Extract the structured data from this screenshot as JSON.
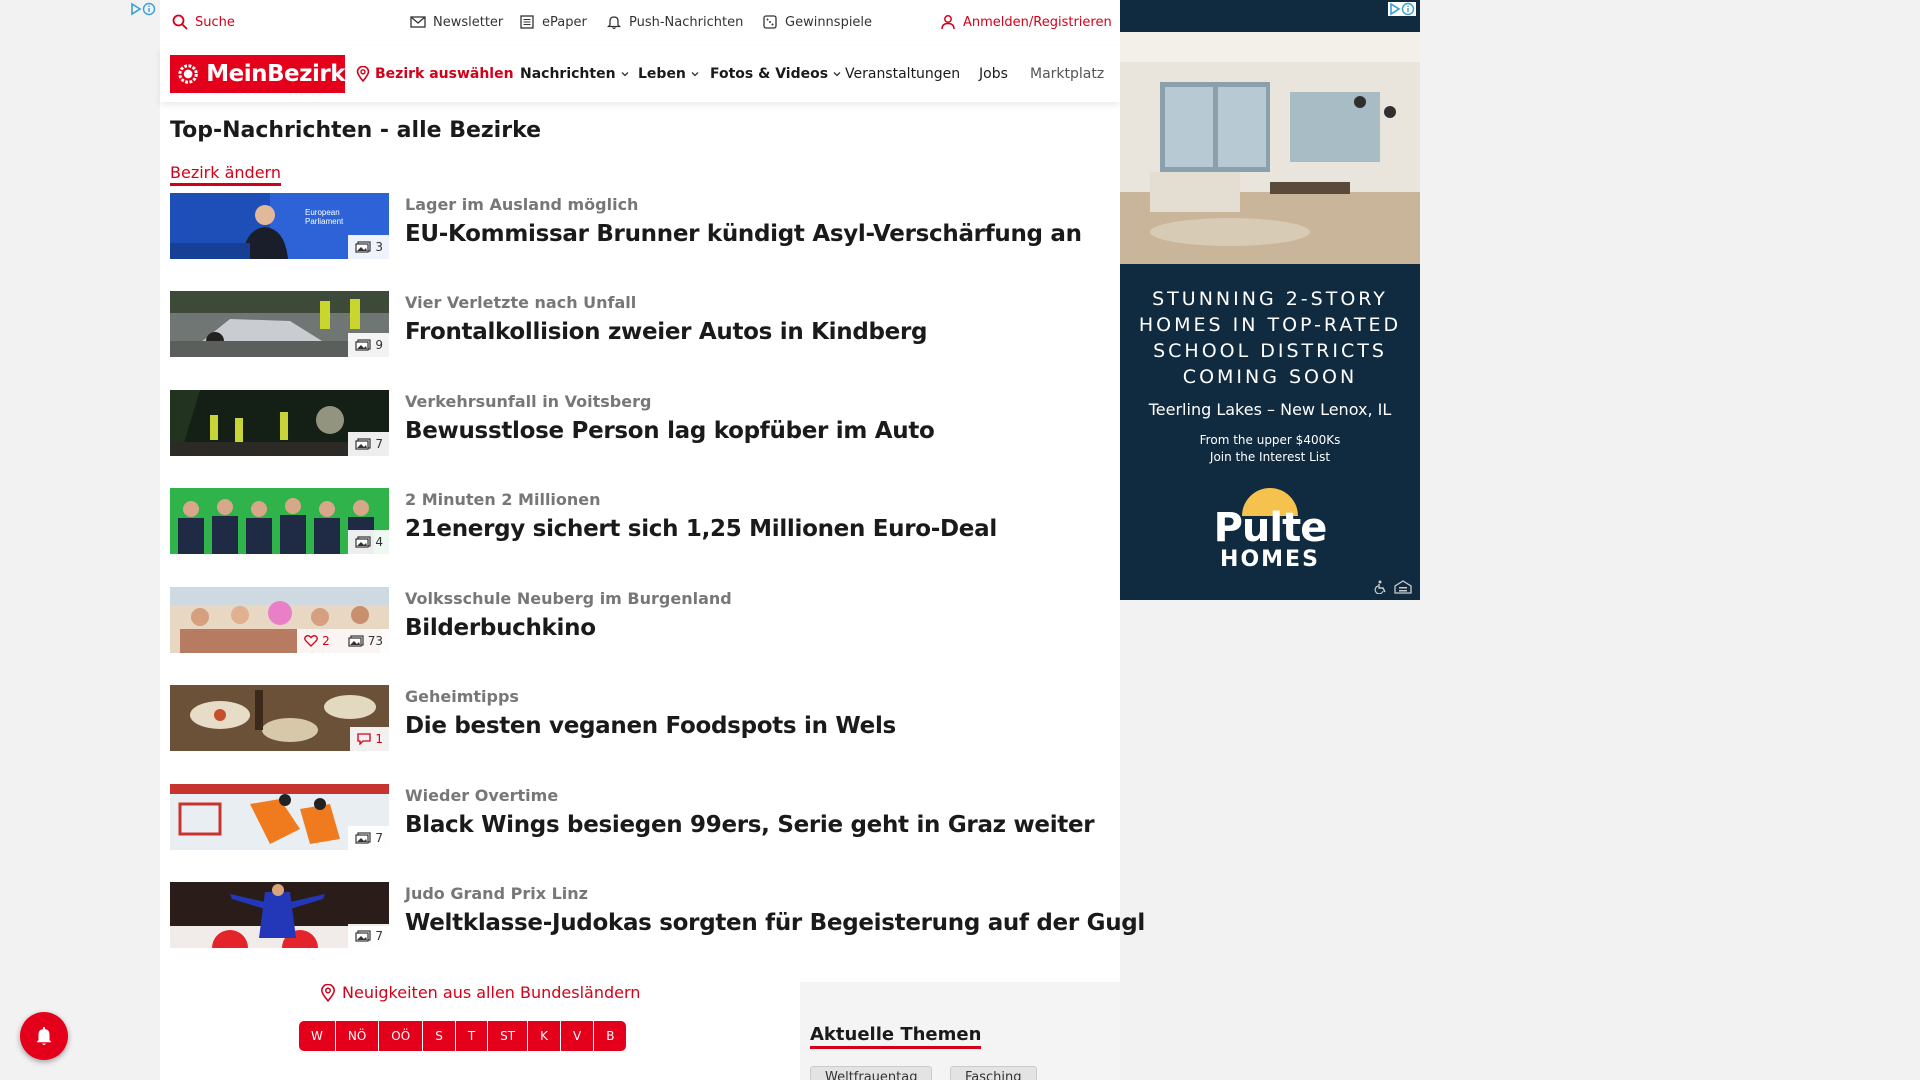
{
  "utility_bar": {
    "search": "Suche",
    "newsletter": "Newsletter",
    "epaper": "ePaper",
    "push": "Push-Nachrichten",
    "gewinnspiele": "Gewinnspiele",
    "login": "Anmelden/Registrieren"
  },
  "nav": {
    "logo": "MeinBezirk",
    "bezirk": "Bezirk auswählen",
    "items": [
      "Nachrichten",
      "Leben",
      "Fotos & Videos",
      "Veranstaltungen",
      "Jobs",
      "Marktplatz"
    ]
  },
  "section": {
    "title": "Top-Nachrichten - alle Bezirke",
    "change_link": "Bezirk ändern"
  },
  "articles": [
    {
      "kicker": "Lager im Ausland möglich",
      "headline": "EU-Kommissar Brunner kündigt Asyl-Verschärfung an",
      "photos": "3",
      "likes": "",
      "comments": ""
    },
    {
      "kicker": "Vier Verletzte nach Unfall",
      "headline": "Frontalkollision zweier Autos in Kindberg",
      "photos": "9",
      "likes": "",
      "comments": ""
    },
    {
      "kicker": "Verkehrsunfall in Voitsberg",
      "headline": "Bewusstlose Person lag kopfüber im Auto",
      "photos": "7",
      "likes": "",
      "comments": ""
    },
    {
      "kicker": "2 Minuten 2 Millionen",
      "headline": "21energy sichert sich 1,25 Millionen Euro-Deal",
      "photos": "4",
      "likes": "",
      "comments": ""
    },
    {
      "kicker": "Volksschule Neuberg im Burgenland",
      "headline": "Bilderbuchkino",
      "photos": "73",
      "likes": "2",
      "comments": ""
    },
    {
      "kicker": "Geheimtipps",
      "headline": "Die besten veganen Foodspots in Wels",
      "photos": "",
      "likes": "",
      "comments": "1"
    },
    {
      "kicker": "Wieder Overtime",
      "headline": "Black Wings besiegen 99ers, Serie geht in Graz weiter",
      "photos": "7",
      "likes": "",
      "comments": ""
    },
    {
      "kicker": "Judo Grand Prix Linz",
      "headline": "Weltklasse-Judokas sorgten für Begeisterung auf der Gugl",
      "photos": "7",
      "likes": "",
      "comments": ""
    }
  ],
  "regions": {
    "title": "Neuigkeiten aus allen Bundesländern",
    "items": [
      "W",
      "NÖ",
      "OÖ",
      "S",
      "T",
      "ST",
      "K",
      "V",
      "B"
    ]
  },
  "themes": {
    "title": "Aktuelle Themen",
    "chips": [
      "Weltfrauentag",
      "Fasching"
    ]
  },
  "ad": {
    "headline_lines": [
      "STUNNING 2-STORY",
      "HOMES IN TOP-RATED",
      "SCHOOL DISTRICTS",
      "COMING SOON"
    ],
    "location": "Teerling Lakes – New Lenox, IL",
    "sub_lines": [
      "From the upper $400Ks",
      "Join the Interest List"
    ],
    "brand_top": "Pulte",
    "brand_bottom": "HOMES"
  },
  "colors": {
    "brand_red": "#e4001b",
    "ad_navy": "#102b3f"
  }
}
